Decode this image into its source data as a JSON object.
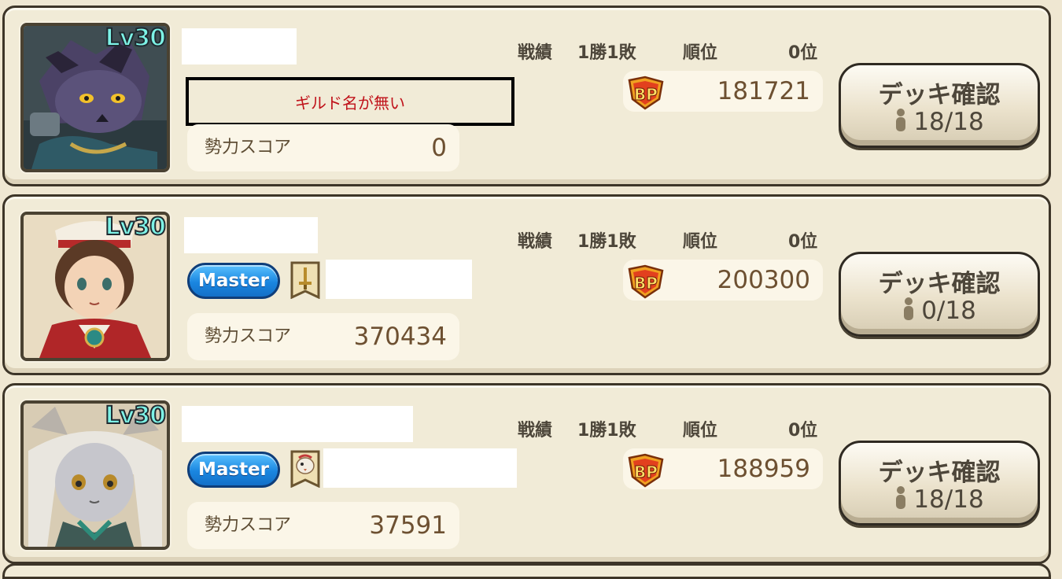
{
  "labels": {
    "record": "戦績",
    "rank": "順位",
    "score": "勢力スコア",
    "deck_button": "デッキ確認"
  },
  "players": [
    {
      "level": "Lv30",
      "portrait": "wolf-knight-portrait",
      "guild_missing_text": "ギルド名が無い",
      "has_guild": false,
      "record": "1勝1敗",
      "rank": "0位",
      "bp": "181721",
      "score": "0",
      "deck_count": "18/18"
    },
    {
      "level": "Lv30",
      "portrait": "red-mage-girl-portrait",
      "has_guild": true,
      "guild_role": "Master",
      "guild_emblem": "sword-banner-icon",
      "record": "1勝1敗",
      "rank": "0位",
      "bp": "200300",
      "score": "370434",
      "deck_count": "0/18"
    },
    {
      "level": "Lv30",
      "portrait": "white-cat-girl-portrait",
      "has_guild": true,
      "guild_role": "Master",
      "guild_emblem": "bird-banner-icon",
      "record": "1勝1敗",
      "rank": "0位",
      "bp": "188959",
      "score": "37591",
      "deck_count": "18/18"
    }
  ],
  "colors": {
    "card_bg": "#f1ebd7",
    "border": "#3d3528",
    "master_badge": "#1a86e0",
    "level_text": "#7df2e6",
    "guild_missing_text": "#c0121a"
  }
}
